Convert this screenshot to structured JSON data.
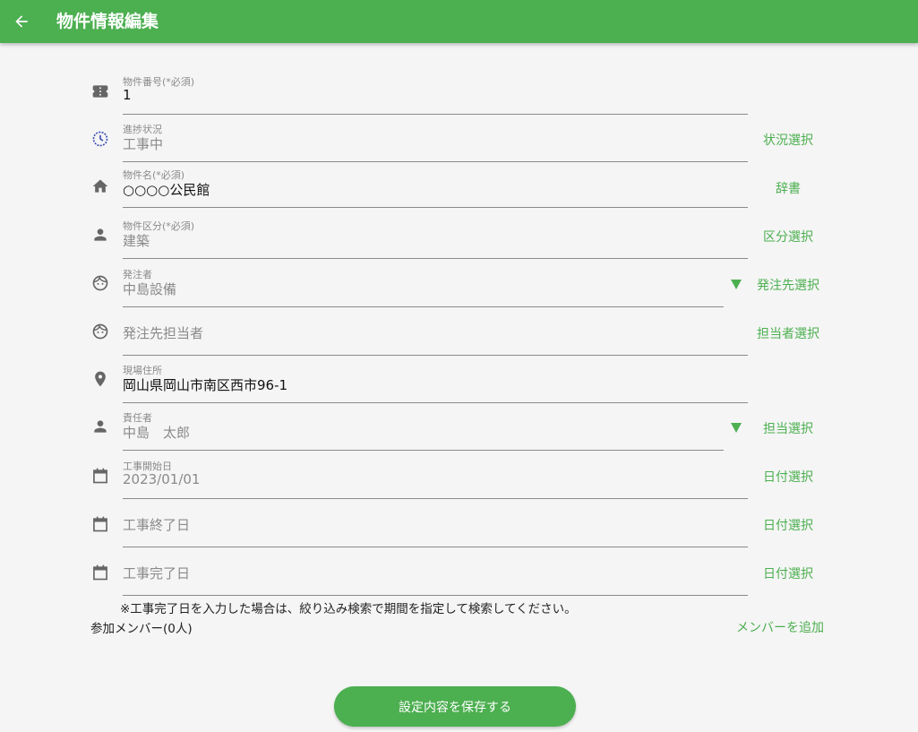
{
  "appbar": {
    "title": "物件情報編集",
    "back_icon": "arrow-left-icon"
  },
  "colors": {
    "primary": "#4caf50",
    "label": "#8a8a8a",
    "divider": "#8a8a8a",
    "progress_icon": "#3f51b5"
  },
  "fields": {
    "property_number": {
      "label": "物件番号(*必須)",
      "value": "1",
      "icon": "ticket-icon"
    },
    "progress": {
      "label": "進捗状況",
      "value": "工事中",
      "icon": "clock-icon",
      "action": "状況選択"
    },
    "property_name": {
      "label": "物件名(*必須)",
      "value": "○○○○公民館",
      "icon": "home-icon",
      "action": "辞書"
    },
    "property_category": {
      "label": "物件区分(*必須)",
      "value": "建築",
      "icon": "person-icon",
      "action": "区分選択"
    },
    "orderer": {
      "label": "発注者",
      "value": "中島設備",
      "icon": "face-icon",
      "action": "発注先選択"
    },
    "orderer_contact": {
      "placeholder": "発注先担当者",
      "icon": "face-icon",
      "action": "担当者選択"
    },
    "site_address": {
      "label": "現場住所",
      "value": "岡山県岡山市南区西市96-1",
      "icon": "location-pin-icon"
    },
    "manager": {
      "label": "責任者",
      "value": "中島　太郎",
      "icon": "person-icon",
      "action": "担当選択"
    },
    "start_date": {
      "label": "工事開始日",
      "value": "2023/01/01",
      "icon": "calendar-icon",
      "action": "日付選択"
    },
    "end_date": {
      "placeholder": "工事終了日",
      "icon": "calendar-icon",
      "action": "日付選択"
    },
    "completion_date": {
      "placeholder": "工事完了日",
      "icon": "calendar-icon",
      "action": "日付選択"
    }
  },
  "note": "※工事完了日を入力した場合は、絞り込み検索で期間を指定して検索してください。",
  "members": {
    "label": "参加メンバー(0人)",
    "add_label": "メンバーを追加"
  },
  "save_button": {
    "label": "設定内容を保存する"
  }
}
